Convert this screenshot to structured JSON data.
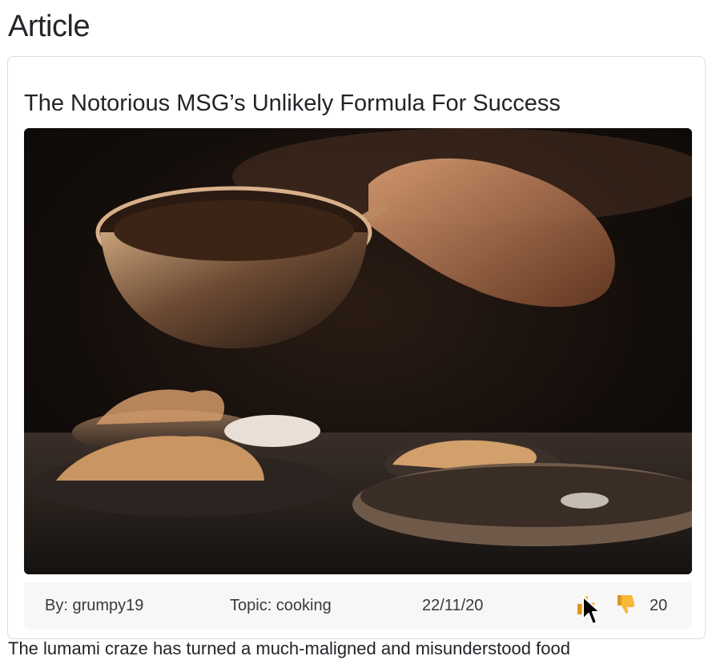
{
  "page": {
    "heading": "Article"
  },
  "article": {
    "title": "The Notorious MSG’s Unlikely Formula For Success",
    "image_alt": "Chef plating dishes in a dimly lit restaurant kitchen",
    "author": "By: grumpy19",
    "topic": "Topic: cooking",
    "date": "22/11/20",
    "votes": "20",
    "body_preview": "The lumami craze has turned a much-maligned and misunderstood food"
  },
  "icons": {
    "upvote": "thumbs-up-icon",
    "downvote": "thumbs-down-icon",
    "cursor": "mouse-pointer-icon"
  },
  "colors": {
    "thumb": "#f6b93b",
    "thumb_shadow": "#e0941c"
  }
}
